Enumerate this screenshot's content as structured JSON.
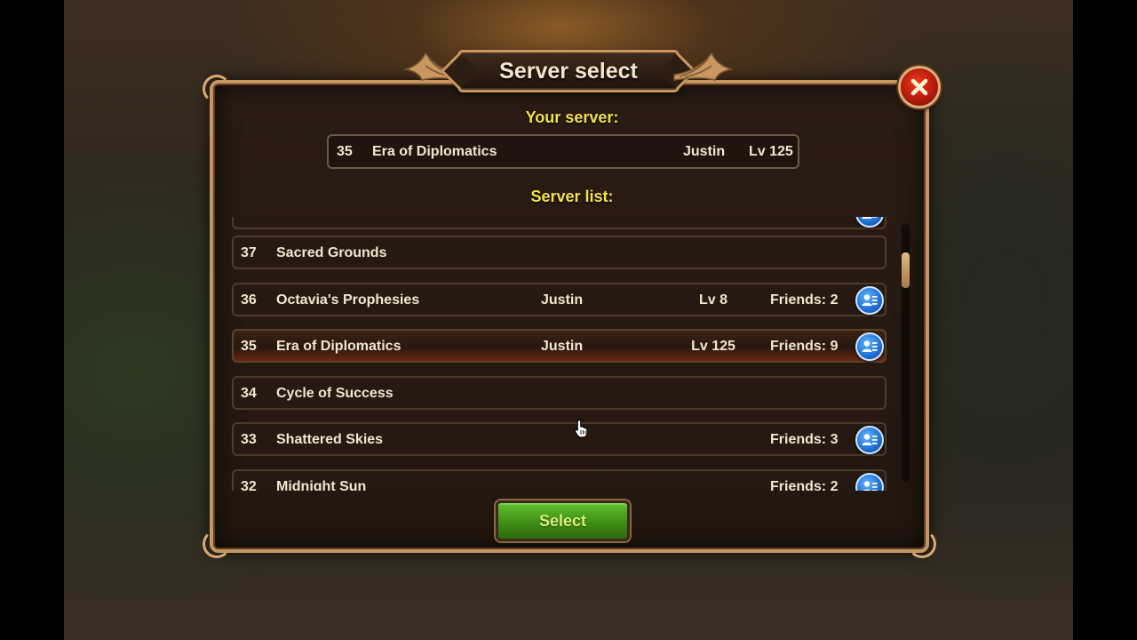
{
  "dialog": {
    "title": "Server select",
    "your_server_label": "Your server:",
    "server_list_label": "Server list:",
    "select_label": "Select"
  },
  "your_server": {
    "number": "35",
    "name": "Era of Diplomatics",
    "player": "Justin",
    "level": "Lv 125"
  },
  "servers": [
    {
      "number": "37",
      "name": "Sacred Grounds",
      "player": "",
      "level": "",
      "friends": ""
    },
    {
      "number": "36",
      "name": "Octavia's Prophesies",
      "player": "Justin",
      "level": "Lv 8",
      "friends": "Friends: 2"
    },
    {
      "number": "35",
      "name": "Era of Diplomatics",
      "player": "Justin",
      "level": "Lv 125",
      "friends": "Friends: 9"
    },
    {
      "number": "34",
      "name": "Cycle of Success",
      "player": "",
      "level": "",
      "friends": ""
    },
    {
      "number": "33",
      "name": "Shattered Skies",
      "player": "",
      "level": "",
      "friends": "Friends: 3"
    },
    {
      "number": "32",
      "name": "Midnight Sun",
      "player": "",
      "level": "",
      "friends": "Friends: 2"
    }
  ],
  "colors": {
    "heading": "#f2e14a",
    "text": "#f2e6cf",
    "frame": "#c59562",
    "select_button": "#3f8e16",
    "close_button": "#b0180a",
    "friend_button": "#1f6fd1"
  },
  "icons": {
    "close": "close-icon",
    "friends": "friends-list-icon",
    "cursor": "hand-cursor-icon"
  }
}
